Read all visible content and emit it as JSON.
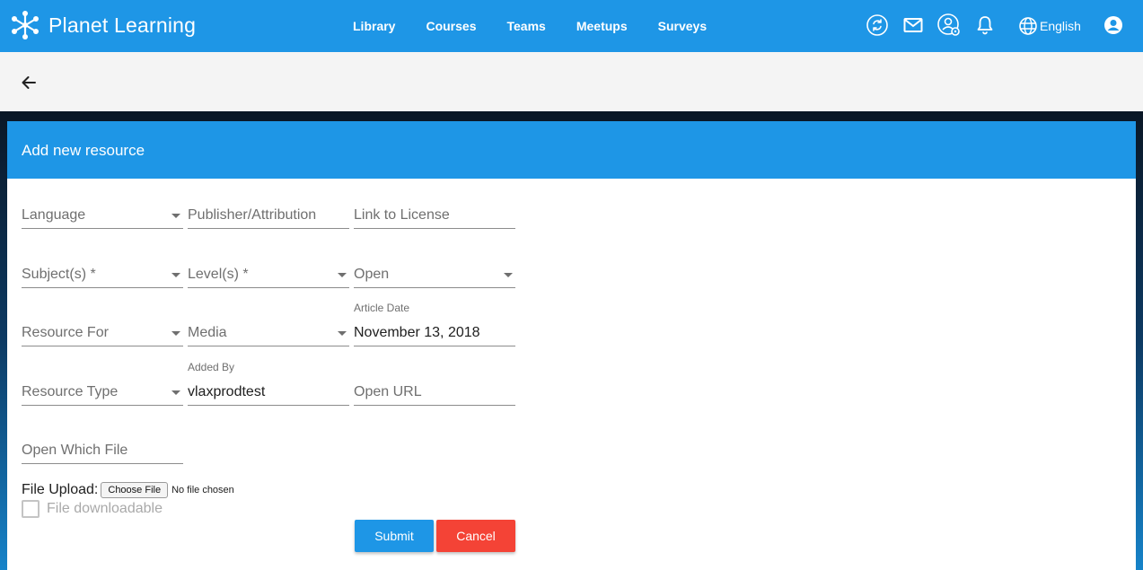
{
  "app": {
    "name": "Planet Learning"
  },
  "nav": {
    "links": [
      "Library",
      "Courses",
      "Teams",
      "Meetups",
      "Surveys"
    ],
    "language": "English",
    "icons": [
      "sync-icon",
      "mail-icon",
      "user-settings-icon",
      "bell-icon",
      "globe-icon",
      "account-circle-icon"
    ]
  },
  "page": {
    "back_icon": "arrow-back-icon"
  },
  "form": {
    "title": "Add new resource",
    "language": {
      "placeholder": "Language"
    },
    "publisher": {
      "placeholder": "Publisher/Attribution"
    },
    "license": {
      "placeholder": "Link to License"
    },
    "subjects": {
      "placeholder": "Subject(s) *"
    },
    "levels": {
      "placeholder": "Level(s) *"
    },
    "open": {
      "value": "Open"
    },
    "resource_for": {
      "placeholder": "Resource For"
    },
    "media": {
      "placeholder": "Media"
    },
    "article_date": {
      "label": "Article Date",
      "value": "November 13, 2018"
    },
    "resource_type": {
      "placeholder": "Resource Type"
    },
    "added_by": {
      "label": "Added By",
      "value": "vlaxprodtest"
    },
    "open_url": {
      "placeholder": "Open URL"
    },
    "open_which_file": {
      "placeholder": "Open Which File"
    },
    "file_upload": {
      "label": "File Upload:",
      "button": "Choose File",
      "status": "No file chosen"
    },
    "downloadable": {
      "label": "File downloadable",
      "checked": false
    },
    "submit_label": "Submit",
    "cancel_label": "Cancel"
  },
  "colors": {
    "primary": "#1e96e6",
    "danger": "#f44336",
    "subbar": "#f4f4f4"
  }
}
